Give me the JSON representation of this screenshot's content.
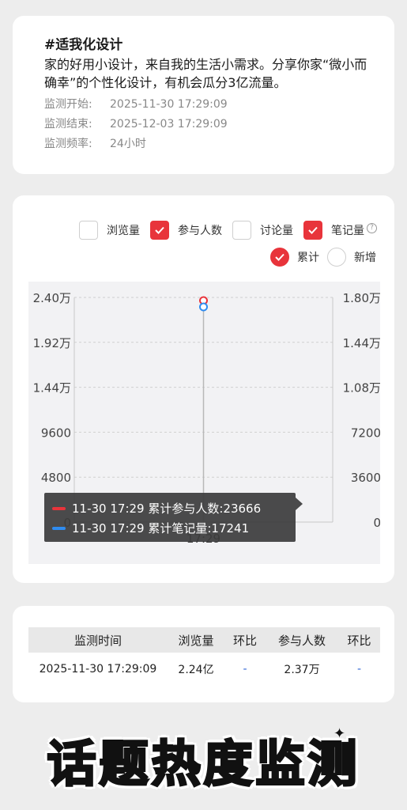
{
  "topic": {
    "title": "#适我化设计",
    "description": "家的好用小设计，来自我的生活小需求。分享你家“微小而确幸”的个性化设计，有机会瓜分3亿流量。",
    "meta": [
      {
        "label": "监测开始:",
        "value": "2025-11-30  17:29:09"
      },
      {
        "label": "监测结束:",
        "value": "2025-12-03  17:29:09"
      },
      {
        "label": "监测频率:",
        "value": "24小时"
      }
    ]
  },
  "metrics": [
    {
      "label": "浏览量",
      "checked": false
    },
    {
      "label": "参与人数",
      "checked": true
    },
    {
      "label": "讨论量",
      "checked": false
    },
    {
      "label": "笔记量",
      "checked": true
    }
  ],
  "modes": [
    {
      "label": "累计",
      "selected": true
    },
    {
      "label": "新增",
      "selected": false
    }
  ],
  "colors": {
    "accent": "#e8343b",
    "series_red": "#e8343b",
    "series_blue": "#2f8cf0"
  },
  "chart_data": {
    "type": "line",
    "x": [
      "17:29"
    ],
    "series": [
      {
        "name": "累计参与人数",
        "axis": "left",
        "values": [
          23666
        ],
        "color": "#e8343b"
      },
      {
        "name": "累计笔记量",
        "axis": "right",
        "values": [
          17241
        ],
        "color": "#2f8cf0"
      }
    ],
    "y_left_ticks": [
      "0",
      "4800",
      "9600",
      "1.44万",
      "1.92万",
      "2.40万"
    ],
    "y_left_range": [
      0,
      24000
    ],
    "y_right_ticks": [
      "0",
      "3600",
      "7200",
      "1.08万",
      "1.44万",
      "1.80万"
    ],
    "y_right_range": [
      0,
      18000
    ],
    "grid": true,
    "tooltip": [
      {
        "text": "11-30 17:29 累计参与人数:23666",
        "color": "#e8343b"
      },
      {
        "text": "11-30 17:29 累计笔记量:17241",
        "color": "#2f8cf0"
      }
    ]
  },
  "table": {
    "headers": [
      "监测时间",
      "浏览量",
      "环比",
      "参与人数",
      "环比"
    ],
    "rows": [
      [
        "2025-11-30 17:29:09",
        "2.24亿",
        "-",
        "2.37万",
        "-"
      ]
    ]
  },
  "banner": {
    "text": "话题热度监测",
    "spark": "✦"
  }
}
